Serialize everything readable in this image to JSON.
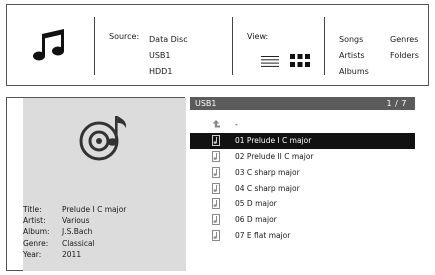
{
  "header": {
    "app_icon": "music-note-icon",
    "source": {
      "label": "Source:",
      "options": [
        "Data Disc",
        "USB1",
        "HDD1"
      ]
    },
    "view": {
      "label": "View:",
      "icons": [
        "list-view-icon",
        "grid-view-icon"
      ]
    },
    "categories": {
      "col_a": [
        "Songs",
        "Artists",
        "Albums"
      ],
      "col_b": [
        "Genres",
        "Folders"
      ]
    }
  },
  "info": {
    "art_icon": "disc-music-icon",
    "fields": [
      {
        "key": "Title:",
        "value": "Prelude I C major"
      },
      {
        "key": "Artist:",
        "value": "Various"
      },
      {
        "key": "Album:",
        "value": "J.S.Bach"
      },
      {
        "key": "Genre:",
        "value": "Classical"
      },
      {
        "key": "Year:",
        "value": "2011"
      }
    ]
  },
  "list": {
    "title": "USB1",
    "page": "1 / 7",
    "up_label": "-",
    "up_icon": "up-arrow-icon",
    "item_icon": "music-file-icon",
    "selected_index": 0,
    "items": [
      "01 Prelude I C major",
      "02 Prelude II C major",
      "03 C sharp major",
      "04 C sharp major",
      "05 D major",
      "06 D major",
      "07 E flat major"
    ]
  },
  "colors": {
    "header_bar": "#5b5b5b",
    "selected_row": "#111111",
    "info_background": "#dcdcdc"
  }
}
